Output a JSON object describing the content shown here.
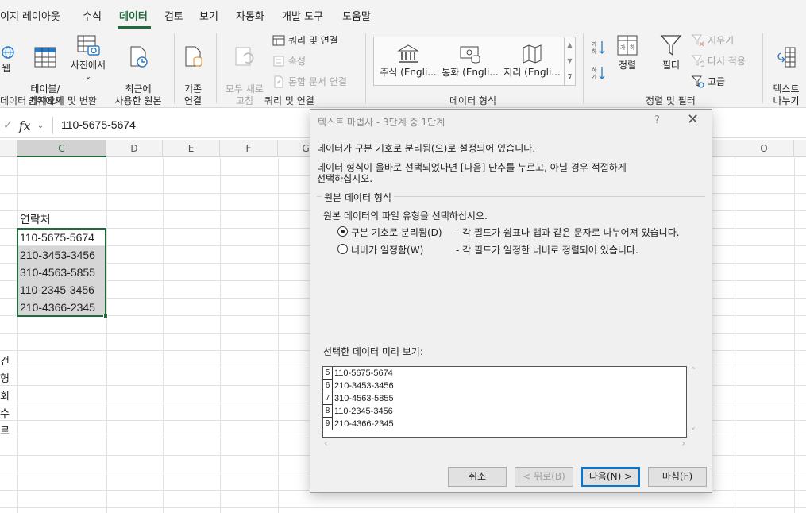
{
  "tabs": [
    "이지 레이아웃",
    "수식",
    "데이터",
    "검토",
    "보기",
    "자동화",
    "개발 도구",
    "도움말"
  ],
  "active_tab": "데이터",
  "ribbon": {
    "get_transform": {
      "partial_left": "웹",
      "table_range": "테이블/\n범위에서",
      "from_picture": "사진에서",
      "recent_sources": "최근에\n사용한 원본",
      "existing_connections": "기존\n연결",
      "group_label": "데이터 가져오기 및 변환"
    },
    "queries": {
      "refresh_all": "모두 새로\n고침",
      "queries_connections": "쿼리 및 연결",
      "properties": "속성",
      "edit_links": "통합 문서 연결",
      "group_label": "쿼리 및 연결"
    },
    "data_types": {
      "stocks": "주식 (Engli...",
      "currencies": "통화 (Engli...",
      "geography": "지리 (Engli...",
      "group_label": "데이터 형식"
    },
    "sort_filter": {
      "sort": "정렬",
      "filter": "필터",
      "clear": "지우기",
      "reapply": "다시 적용",
      "advanced": "고급",
      "group_label": "정렬 및 필터"
    },
    "text_to_columns": "텍스트\n나누기"
  },
  "formula_bar": {
    "fx_label": "fx",
    "value": "110-5675-5674"
  },
  "columns": [
    "C",
    "D",
    "E",
    "F",
    "G",
    "O"
  ],
  "selected_column": "C",
  "cells": {
    "header": "연락처",
    "values": [
      "110-5675-5674",
      "210-3453-3456",
      "310-4563-5855",
      "110-2345-3456",
      "210-4366-2345"
    ]
  },
  "side_chars": [
    "건",
    "형",
    "회",
    "수",
    "르"
  ],
  "dialog": {
    "title": "텍스트 마법사 - 3단계 중 1단계",
    "help": "?",
    "intro1": "데이터가 구분 기호로 분리됨(으)로 설정되어 있습니다.",
    "intro2": "데이터 형식이 올바로 선택되었다면 [다음] 단추를 누르고, 아닐 경우 적절하게",
    "intro3": "선택하십시오.",
    "fieldset_label": "원본 데이터 형식",
    "fieldset_prompt": "원본 데이터의 파일 유형을 선택하십시오.",
    "options": [
      {
        "label": "구분 기호로 분리됨(D)",
        "desc": "- 각 필드가 쉼표나 탭과 같은 문자로 나누어져 있습니다.",
        "selected": true
      },
      {
        "label": "너비가 일정함(W)",
        "desc": "- 각 필드가 일정한 너비로 정렬되어 있습니다.",
        "selected": false
      }
    ],
    "preview_label": "선택한 데이터 미리 보기:",
    "preview_rows": [
      {
        "num": "5",
        "value": "110-5675-5674"
      },
      {
        "num": "6",
        "value": "210-3453-3456"
      },
      {
        "num": "7",
        "value": "310-4563-5855"
      },
      {
        "num": "8",
        "value": "110-2345-3456"
      },
      {
        "num": "9",
        "value": "210-4366-2345"
      }
    ],
    "buttons": {
      "cancel": "취소",
      "back": "< 뒤로(B)",
      "next": "다음(N) >",
      "finish": "마침(F)"
    }
  },
  "colors": {
    "accent": "#1e6b3c",
    "selection": "#d6d6d6",
    "primary_button_border": "#0078d7"
  }
}
